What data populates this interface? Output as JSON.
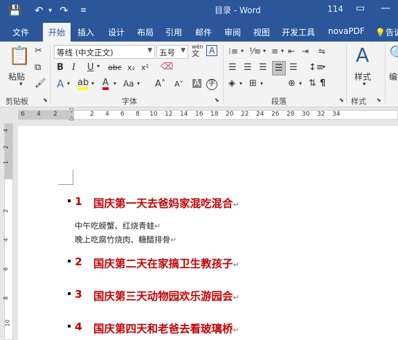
{
  "window": {
    "title": "目录 - Word",
    "page_number": "114"
  },
  "tabs": [
    "文件",
    "开始",
    "插入",
    "设计",
    "布局",
    "引用",
    "邮件",
    "审阅",
    "视图",
    "开发工具",
    "novaPDF",
    "告诉"
  ],
  "ribbon": {
    "clipboard": {
      "paste_label": "粘贴",
      "group_label": "剪贴板"
    },
    "font": {
      "font_name": "等线 (中文正文)",
      "font_size": "五号",
      "group_label": "字体",
      "wen_label": "wén",
      "wen_char": "文",
      "boxed_char": "A"
    },
    "paragraph": {
      "group_label": "段落"
    },
    "styles": {
      "button_label": "样式",
      "group_label": "样式"
    },
    "editing": {
      "button_label": "编"
    }
  },
  "ruler": {
    "horizontal": [
      "6",
      "4",
      "2",
      "2",
      "4",
      "6",
      "8",
      "10",
      "12",
      "14",
      "16",
      "18",
      "20",
      "22",
      "24",
      "26",
      "28",
      "30",
      "32",
      "34"
    ],
    "vertical": [
      "4",
      "2",
      "1",
      "2",
      "4",
      "6",
      "8",
      "10"
    ]
  },
  "document": {
    "headings": [
      {
        "num": "1",
        "text": "国庆第一天去爸妈家混吃混合"
      },
      {
        "num": "2",
        "text": "国庆第二天在家搞卫生教孩子"
      },
      {
        "num": "3",
        "text": "国庆第三天动物园欢乐游园会"
      },
      {
        "num": "4",
        "text": "国庆第四天和老爸去看玻璃桥"
      }
    ],
    "body": [
      "中午吃螃蟹、红烧青蛙",
      "晚上吃腐竹烧肉、糖醋排骨"
    ],
    "para_mark": "↵"
  },
  "colors": {
    "accent": "#2b579a",
    "heading": "#c00000"
  }
}
